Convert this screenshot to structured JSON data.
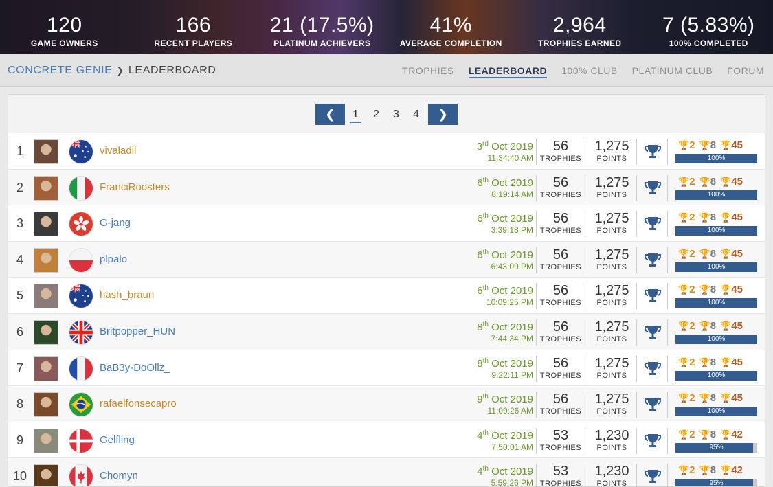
{
  "stats": [
    {
      "value": "120",
      "label": "GAME OWNERS"
    },
    {
      "value": "166",
      "label": "RECENT PLAYERS"
    },
    {
      "value": "21 (17.5%)",
      "label": "PLATINUM ACHIEVERS"
    },
    {
      "value": "41%",
      "label": "AVERAGE COMPLETION"
    },
    {
      "value": "2,964",
      "label": "TROPHIES EARNED"
    },
    {
      "value": "7 (5.83%)",
      "label": "100% COMPLETED"
    }
  ],
  "breadcrumb": {
    "game": "CONCRETE GENIE",
    "separator": "❯",
    "current": "LEADERBOARD"
  },
  "tabs": [
    "TROPHIES",
    "LEADERBOARD",
    "100% CLUB",
    "PLATINUM CLUB",
    "FORUM"
  ],
  "active_tab": "LEADERBOARD",
  "pager": {
    "prev": "❮",
    "next": "❯",
    "pages": [
      "1",
      "2",
      "3",
      "4"
    ],
    "current": "1"
  },
  "colors": {
    "accent": "#345c8e",
    "link_gold": "#c78b2a",
    "link_blue": "#4a7db5",
    "date_green": "#6d9a2c"
  },
  "labels": {
    "trophies": "TROPHIES",
    "points": "POINTS"
  },
  "rows": [
    {
      "rank": "1",
      "name": "vivaladil",
      "name_color": "#c78b2a",
      "flag": "au",
      "day": "3",
      "suffix": "rd",
      "month_year": "Oct 2019",
      "time": "11:34:40 AM",
      "trophies": "56",
      "points": "1,275",
      "gold": "2",
      "silver": "8",
      "bronze": "45",
      "progress": "100%",
      "progress_value": 100,
      "avatar": "#6b4a3a"
    },
    {
      "rank": "2",
      "name": "FranciRoosters",
      "name_color": "#c78b2a",
      "flag": "it",
      "day": "6",
      "suffix": "th",
      "month_year": "Oct 2019",
      "time": "8:19:14 AM",
      "trophies": "56",
      "points": "1,275",
      "gold": "2",
      "silver": "8",
      "bronze": "45",
      "progress": "100%",
      "progress_value": 100,
      "avatar": "#a0603a"
    },
    {
      "rank": "3",
      "name": "G-jang",
      "name_color": "#4a7db5",
      "flag": "hk",
      "day": "6",
      "suffix": "th",
      "month_year": "Oct 2019",
      "time": "3:39:18 PM",
      "trophies": "56",
      "points": "1,275",
      "gold": "2",
      "silver": "8",
      "bronze": "45",
      "progress": "100%",
      "progress_value": 100,
      "avatar": "#3a3a3a"
    },
    {
      "rank": "4",
      "name": "plpalo",
      "name_color": "#4a7db5",
      "flag": "pl",
      "day": "6",
      "suffix": "th",
      "month_year": "Oct 2019",
      "time": "6:43:09 PM",
      "trophies": "56",
      "points": "1,275",
      "gold": "2",
      "silver": "8",
      "bronze": "45",
      "progress": "100%",
      "progress_value": 100,
      "avatar": "#c0803a"
    },
    {
      "rank": "5",
      "name": "hash_braun",
      "name_color": "#c78b2a",
      "flag": "au",
      "day": "6",
      "suffix": "th",
      "month_year": "Oct 2019",
      "time": "10:09:25 PM",
      "trophies": "56",
      "points": "1,275",
      "gold": "2",
      "silver": "8",
      "bronze": "45",
      "progress": "100%",
      "progress_value": 100,
      "avatar": "#8a7a7a"
    },
    {
      "rank": "6",
      "name": "Britpopper_HUN",
      "name_color": "#4a7db5",
      "flag": "gb",
      "day": "8",
      "suffix": "th",
      "month_year": "Oct 2019",
      "time": "7:44:34 PM",
      "trophies": "56",
      "points": "1,275",
      "gold": "2",
      "silver": "8",
      "bronze": "45",
      "progress": "100%",
      "progress_value": 100,
      "avatar": "#2a4a2a"
    },
    {
      "rank": "7",
      "name": "BaB3y-DoOllz_",
      "name_color": "#4a7db5",
      "flag": "fr",
      "day": "8",
      "suffix": "th",
      "month_year": "Oct 2019",
      "time": "9:22:11 PM",
      "trophies": "56",
      "points": "1,275",
      "gold": "2",
      "silver": "8",
      "bronze": "45",
      "progress": "100%",
      "progress_value": 100,
      "avatar": "#8a5a5a"
    },
    {
      "rank": "8",
      "name": "rafaelfonsecapro",
      "name_color": "#c78b2a",
      "flag": "br",
      "day": "9",
      "suffix": "th",
      "month_year": "Oct 2019",
      "time": "11:09:26 AM",
      "trophies": "56",
      "points": "1,275",
      "gold": "2",
      "silver": "8",
      "bronze": "45",
      "progress": "100%",
      "progress_value": 100,
      "avatar": "#7a4a2a"
    },
    {
      "rank": "9",
      "name": "Gelfling",
      "name_color": "#4a7db5",
      "flag": "dk",
      "day": "4",
      "suffix": "th",
      "month_year": "Oct 2019",
      "time": "7:50:01 AM",
      "trophies": "53",
      "points": "1,230",
      "gold": "2",
      "silver": "8",
      "bronze": "42",
      "progress": "95%",
      "progress_value": 95,
      "avatar": "#8a8a7a"
    },
    {
      "rank": "10",
      "name": "Chomyn",
      "name_color": "#4a7db5",
      "flag": "ca",
      "day": "4",
      "suffix": "th",
      "month_year": "Oct 2019",
      "time": "5:59:26 PM",
      "trophies": "53",
      "points": "1,230",
      "gold": "2",
      "silver": "8",
      "bronze": "42",
      "progress": "95%",
      "progress_value": 95,
      "avatar": "#5a3a1a"
    }
  ]
}
